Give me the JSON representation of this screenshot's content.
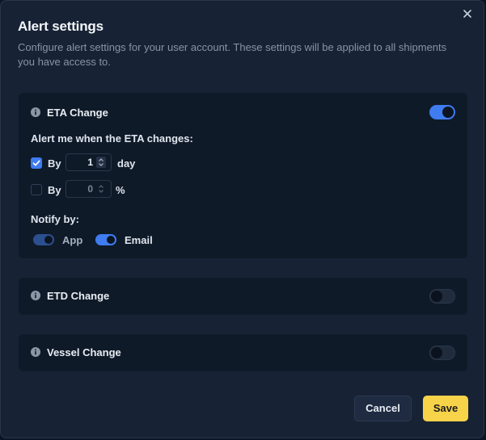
{
  "dialog": {
    "title": "Alert settings",
    "description": "Configure alert settings for your user account. These settings will be applied to all shipments you have access to.",
    "close_icon": "close-icon"
  },
  "eta_card": {
    "title": "ETA Change",
    "enabled": true,
    "alert_heading": "Alert me when the ETA changes:",
    "by_days": {
      "label": "By",
      "checked": true,
      "value": "1",
      "unit": "day"
    },
    "by_percent": {
      "label": "By",
      "checked": false,
      "value": "0",
      "unit": "%"
    },
    "notify_heading": "Notify by:",
    "notify_app": {
      "label": "App",
      "enabled": true
    },
    "notify_email": {
      "label": "Email",
      "enabled": true
    }
  },
  "etd_card": {
    "title": "ETD Change",
    "enabled": false
  },
  "vessel_card": {
    "title": "Vessel Change",
    "enabled": false
  },
  "footer": {
    "cancel_label": "Cancel",
    "save_label": "Save"
  },
  "colors": {
    "accent": "#3f7cf0",
    "save_button": "#f7d34a",
    "background": "#172235",
    "card": "#0f1a29"
  }
}
